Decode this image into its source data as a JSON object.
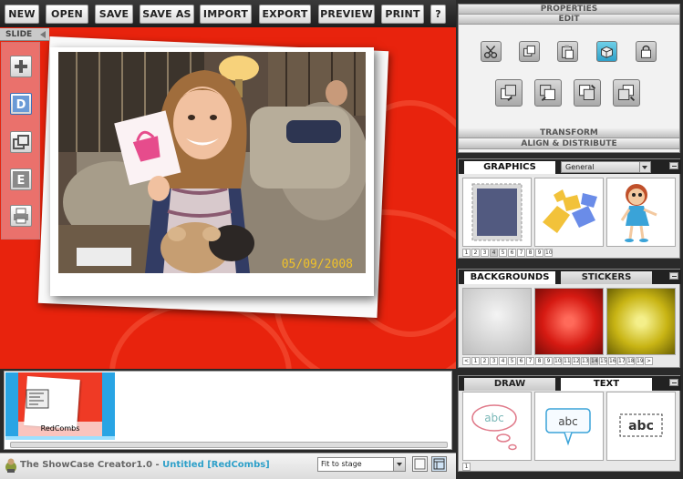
{
  "toolbar": {
    "new": "NEW",
    "open": "OPEN",
    "save": "SAVE",
    "save_as": "SAVE AS",
    "import": "IMPORT",
    "export": "EXPORT",
    "preview": "PREVIEW",
    "print": "PRINT",
    "help": "?"
  },
  "slide": {
    "label": "SLIDE",
    "buttons": {
      "add": "+",
      "duplicate": "D",
      "edit": "E"
    }
  },
  "stage": {
    "date_stamp": "05/09/2008"
  },
  "timeline": {
    "slide_name": "RedCombs"
  },
  "status": {
    "app_name": "The ShowCase Creator1.0 - ",
    "document": "Untitled [RedCombs]",
    "zoom": "Fit to stage"
  },
  "properties": {
    "title": "PROPERTIES",
    "edit": "EDIT",
    "transform": "TRANSFORM",
    "align": "ALIGN & DISTRIBUTE"
  },
  "graphics": {
    "tab": "GRAPHICS",
    "category": "General",
    "pages": [
      "1",
      "2",
      "3",
      "4",
      "5",
      "6",
      "7",
      "8",
      "9",
      "10"
    ],
    "selected_page": "4"
  },
  "backgrounds": {
    "tab_backgrounds": "BACKGROUNDS",
    "tab_stickers": "STICKERS",
    "pages": [
      "<",
      "1",
      "2",
      "3",
      "4",
      "5",
      "6",
      "7",
      "8",
      "9",
      "10",
      "11",
      "12",
      "13",
      "14",
      "15",
      "16",
      "17",
      "18",
      "19",
      ">"
    ],
    "selected_page": "14"
  },
  "draw": {
    "tab_draw": "DRAW",
    "tab_text": "TEXT",
    "label_abc": "abc",
    "pages": [
      "1"
    ]
  },
  "colors": {
    "stage_red": "#e8230d",
    "timeline_blue": "#29a4e4",
    "accent_doc": "#2ea0c9",
    "date_yellow": "#f0c22a"
  }
}
